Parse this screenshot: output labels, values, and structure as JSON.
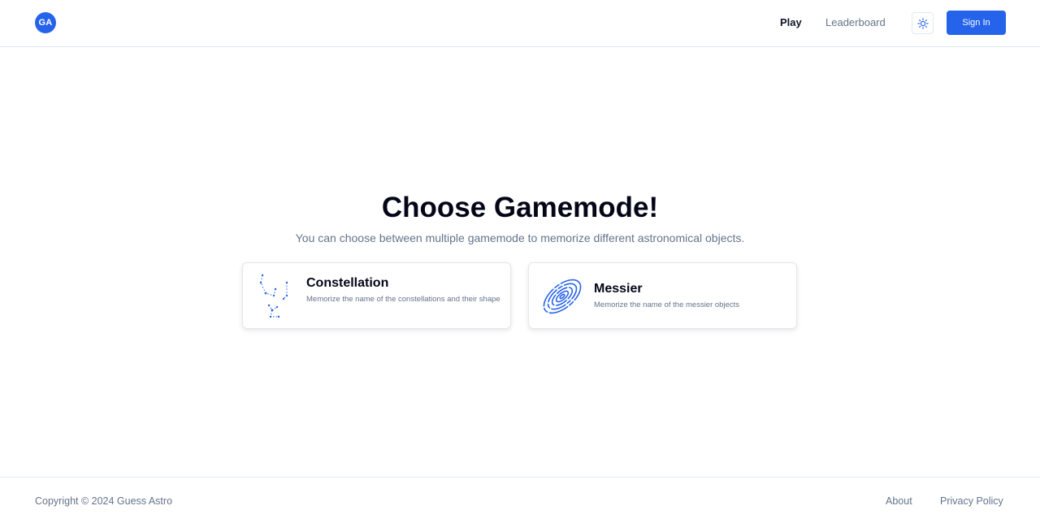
{
  "header": {
    "logo_text": "GA",
    "nav": {
      "play": "Play",
      "leaderboard": "Leaderboard"
    },
    "theme_icon": "sun-icon",
    "signin_label": "Sign In"
  },
  "main": {
    "title": "Choose Gamemode!",
    "subtitle": "You can choose between multiple gamemode to memorize different astronomical objects.",
    "cards": [
      {
        "title": "Constellation",
        "description": "Memorize the name of the constellations and their shape",
        "icon": "constellation-icon"
      },
      {
        "title": "Messier",
        "description": "Memorize the name of the messier objects",
        "icon": "galaxy-icon"
      }
    ]
  },
  "footer": {
    "copyright": "Copyright © 2024 Guess Astro",
    "links": {
      "about": "About",
      "privacy": "Privacy Policy"
    }
  },
  "colors": {
    "accent": "#2563eb",
    "muted_text": "#64748b",
    "border": "#e2e8f0"
  }
}
